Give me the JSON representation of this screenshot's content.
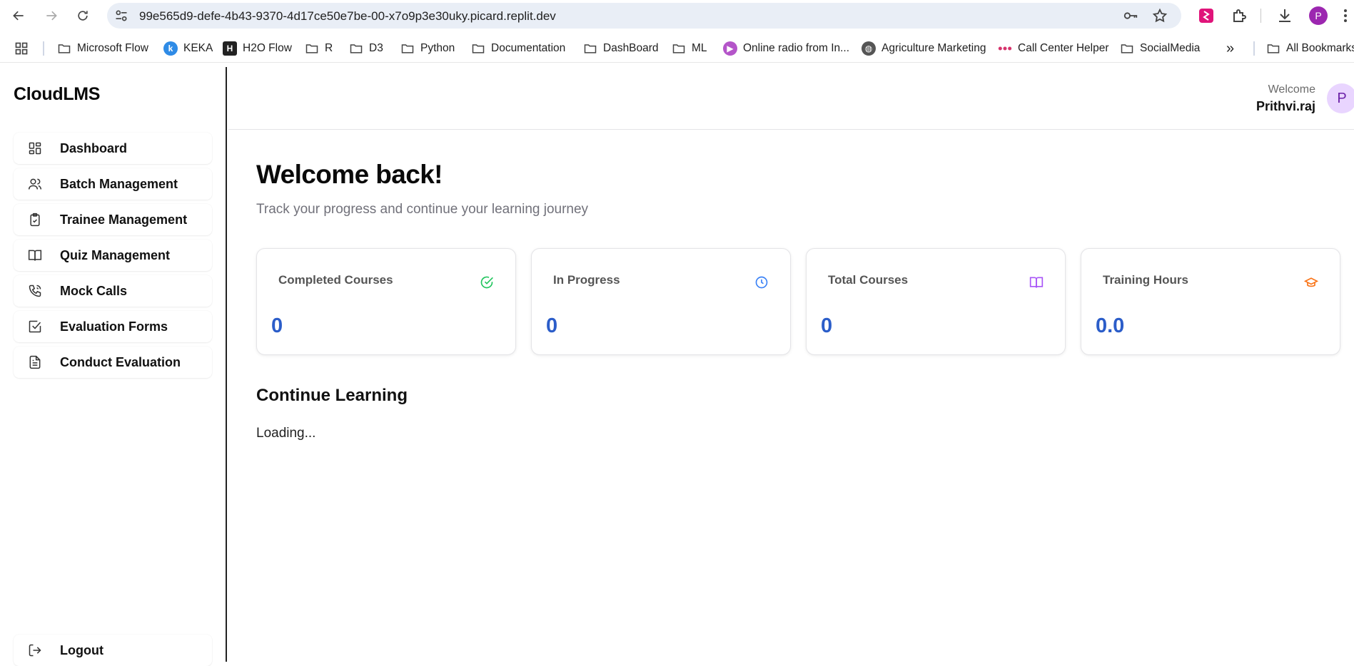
{
  "browser": {
    "url": "99e565d9-defe-4b43-9370-4d17ce50e7be-00-x7o9p3e30uky.picard.replit.dev",
    "profile_initial": "P",
    "icons": [
      "back-icon",
      "forward-icon",
      "reload-icon",
      "site-settings-icon",
      "password-key-icon",
      "bookmark-star-icon",
      "extension-icon",
      "puzzle-icon",
      "download-icon",
      "kebab-menu-icon"
    ]
  },
  "bookmarks": {
    "items": [
      {
        "label": "Microsoft Flow",
        "icon": "folder-icon"
      },
      {
        "label": "KEKA",
        "icon": "keka-icon"
      },
      {
        "label": "H2O Flow",
        "icon": "h2o-icon"
      },
      {
        "label": "R",
        "icon": "folder-icon"
      },
      {
        "label": "D3",
        "icon": "folder-icon"
      },
      {
        "label": "Python",
        "icon": "folder-icon"
      },
      {
        "label": "Documentation",
        "icon": "folder-icon"
      },
      {
        "label": "DashBoard",
        "icon": "folder-icon"
      },
      {
        "label": "ML",
        "icon": "folder-icon"
      },
      {
        "label": "Online radio from In...",
        "icon": "radio-icon"
      },
      {
        "label": "Agriculture Marketing",
        "icon": "globe-icon"
      },
      {
        "label": "Call Center Helper",
        "icon": "dots-icon"
      },
      {
        "label": "SocialMedia",
        "icon": "folder-icon"
      }
    ],
    "overflow": "»",
    "all_bookmarks": "All Bookmarks"
  },
  "app": {
    "brand": "CloudLMS",
    "menu": [
      {
        "label": "Dashboard",
        "icon": "dashboard-grid-icon"
      },
      {
        "label": "Batch Management",
        "icon": "users-icon"
      },
      {
        "label": "Trainee Management",
        "icon": "clipboard-check-icon"
      },
      {
        "label": "Quiz Management",
        "icon": "book-open-icon"
      },
      {
        "label": "Mock Calls",
        "icon": "phone-icon"
      },
      {
        "label": "Evaluation Forms",
        "icon": "checkbox-icon"
      },
      {
        "label": "Conduct Evaluation",
        "icon": "file-text-icon"
      }
    ],
    "logout": "Logout"
  },
  "header": {
    "welcome": "Welcome",
    "username": "Prithvi.raj",
    "avatar_initial": "P"
  },
  "main": {
    "title": "Welcome back!",
    "subtitle": "Track your progress and continue your learning journey",
    "stats": [
      {
        "label": "Completed Courses",
        "value": "0",
        "icon": "check-circle-icon",
        "color": "#22c55e"
      },
      {
        "label": "In Progress",
        "value": "0",
        "icon": "clock-icon",
        "color": "#3b82f6"
      },
      {
        "label": "Total Courses",
        "value": "0",
        "icon": "book-icon",
        "color": "#a855f7"
      },
      {
        "label": "Training Hours",
        "value": "0.0",
        "icon": "graduation-cap-icon",
        "color": "#f97316"
      }
    ],
    "section_title": "Continue Learning",
    "loading": "Loading..."
  },
  "colors": {
    "accent_value": "#2b5dc9",
    "avatar_bg": "#e9d5ff",
    "omnibox_bg": "#e9eef6"
  }
}
